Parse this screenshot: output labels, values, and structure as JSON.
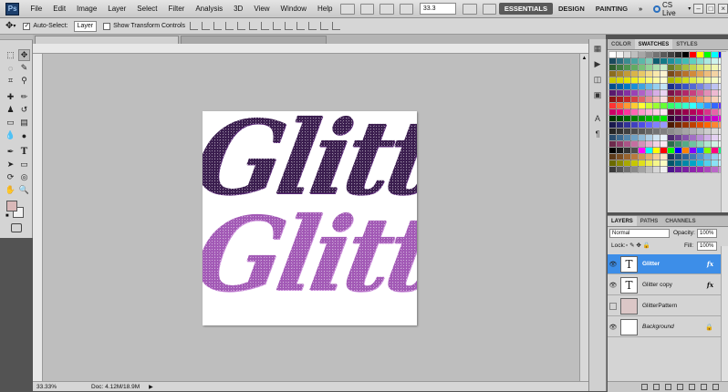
{
  "app": {
    "logo": "Ps"
  },
  "menu": {
    "items": [
      "File",
      "Edit",
      "Image",
      "Layer",
      "Select",
      "Filter",
      "Analysis",
      "3D",
      "View",
      "Window",
      "Help"
    ]
  },
  "menubar": {
    "zoom": "33.3",
    "workspaces": [
      "ESSENTIALS",
      "DESIGN",
      "PAINTING"
    ],
    "more": "»",
    "cs_live": "CS Live"
  },
  "options": {
    "auto_select_label": "Auto-Select:",
    "auto_select_value": "Layer",
    "show_transform_label": "Show Transform Controls"
  },
  "document": {
    "text": "Glitter"
  },
  "status": {
    "zoom": "33.33%",
    "doc_info": "Doc: 4.12M/18.9M"
  },
  "swatches_panel": {
    "tabs": [
      "COLOR",
      "SWATCHES",
      "STYLES"
    ],
    "colors": [
      "#ffffff",
      "#f2f2f2",
      "#d9d9d9",
      "#bfbfbf",
      "#a6a6a6",
      "#8c8c8c",
      "#737373",
      "#595959",
      "#404040",
      "#262626",
      "#000000",
      "#ff0000",
      "#ffff00",
      "#00ff00",
      "#00ffff",
      "#0000ff",
      "#1b4a5c",
      "#2d6e7e",
      "#3c8b8f",
      "#4aa3a0",
      "#5cb8a8",
      "#7fc9b5",
      "#0e5e6f",
      "#127a86",
      "#1d8f9a",
      "#2aa6ab",
      "#3fbcb5",
      "#5fcfc0",
      "#86dccf",
      "#aae8df",
      "#cdf2ec",
      "#e6f9f5",
      "#2e5d2e",
      "#3f7a3f",
      "#4f944f",
      "#62ab62",
      "#78c078",
      "#93d293",
      "#aee0ae",
      "#c8ebc8",
      "#6a7d2a",
      "#8a9f33",
      "#a9bd3f",
      "#c3d44f",
      "#d8e56b",
      "#e7ef8e",
      "#f1f6b3",
      "#f8fbd7",
      "#8c6d1f",
      "#a8832a",
      "#c39b36",
      "#d9b44a",
      "#e8c966",
      "#f2da88",
      "#f8e8ab",
      "#fcf3cf",
      "#7a4a1a",
      "#985d22",
      "#b8722b",
      "#d28a3a",
      "#e3a457",
      "#eebd7c",
      "#f5d3a3",
      "#fae8cd",
      "#c8c800",
      "#d6d600",
      "#e3e300",
      "#eeee1c",
      "#f5f54a",
      "#f9f978",
      "#fbfba5",
      "#fdfdd2",
      "#a8b400",
      "#bccb00",
      "#cfdd1a",
      "#ddeb46",
      "#e8f372",
      "#f0f89c",
      "#f6fbc4",
      "#fafde2",
      "#004f8c",
      "#0063a8",
      "#0078c4",
      "#1a8fd6",
      "#3fa4e0",
      "#6ab9e8",
      "#96cff0",
      "#c2e4f7",
      "#1c2f8a",
      "#2a40a8",
      "#3a53c4",
      "#5569d4",
      "#7683e0",
      "#9aa3ea",
      "#bec3f2",
      "#e0e2f9",
      "#5a1a6e",
      "#6f2487",
      "#842fa0",
      "#9a42b5",
      "#af62c6",
      "#c387d6",
      "#d6aee5",
      "#e9d3f2",
      "#7a1448",
      "#961c58",
      "#b12769",
      "#c7407f",
      "#d6659a",
      "#e38fb6",
      "#eeb9d2",
      "#f7dde9",
      "#8c1414",
      "#a81c1c",
      "#c42727",
      "#d64040",
      "#e06565",
      "#e88f8f",
      "#f0b9b9",
      "#f8dddd",
      "#a83a14",
      "#c44a1c",
      "#dc5c27",
      "#e87840",
      "#f09665",
      "#f5b48f",
      "#f9d1b9",
      "#fce8dd",
      "#ff3333",
      "#ff6633",
      "#ff9933",
      "#ffcc33",
      "#ffff33",
      "#ccff33",
      "#99ff33",
      "#66ff33",
      "#33ff66",
      "#33ff99",
      "#33ffcc",
      "#33ffff",
      "#33ccff",
      "#3399ff",
      "#3366ff",
      "#6633ff",
      "#cc0066",
      "#e6007a",
      "#ff3399",
      "#ff66b3",
      "#ff99cc",
      "#ffb3d9",
      "#ffcce6",
      "#ffe6f2",
      "#660033",
      "#800040",
      "#99004d",
      "#b3005a",
      "#cc0066",
      "#d9338a",
      "#e666a8",
      "#f299c7",
      "#003300",
      "#004d00",
      "#006600",
      "#008000",
      "#009900",
      "#00b300",
      "#00cc00",
      "#00e600",
      "#330033",
      "#4d004d",
      "#660066",
      "#800080",
      "#990099",
      "#b300b3",
      "#cc00cc",
      "#e600e6",
      "#1a1a4d",
      "#262673",
      "#333399",
      "#4040bf",
      "#4d4de6",
      "#6666ff",
      "#8080ff",
      "#9999ff",
      "#4d1a00",
      "#732600",
      "#993300",
      "#bf4000",
      "#e64d00",
      "#ff6600",
      "#ff8533",
      "#ffa366",
      "#262626",
      "#333333",
      "#404040",
      "#4d4d4d",
      "#595959",
      "#666666",
      "#737373",
      "#808080",
      "#8c8c8c",
      "#999999",
      "#a6a6a6",
      "#b3b3b3",
      "#bfbfbf",
      "#cccccc",
      "#d9d9d9",
      "#e6e6e6",
      "#2b4d6e",
      "#3d6a8f",
      "#5486ab",
      "#6fa1c4",
      "#8fbad7",
      "#b0d0e6",
      "#d1e5f2",
      "#e8f2f9",
      "#4d2b6e",
      "#6a3d8f",
      "#8654ab",
      "#a16fc4",
      "#ba8fd7",
      "#d0b0e6",
      "#e5d1f2",
      "#f2e8f9",
      "#6e2b4d",
      "#8f3d6a",
      "#ab5486",
      "#c46fa1",
      "#d78fba",
      "#e6b0d0",
      "#f2d1e5",
      "#f9e8f2",
      "#2b6e4d",
      "#3d8f6a",
      "#54ab86",
      "#6fc4a1",
      "#8fd7ba",
      "#b0e6d0",
      "#d1f2e5",
      "#e8f9f2",
      "#000000",
      "#1a1a1a",
      "#333333",
      "#4d4d4d",
      "#ff00ff",
      "#00ffff",
      "#ffff00",
      "#ff0000",
      "#00ff00",
      "#0000ff",
      "#ff8000",
      "#8000ff",
      "#0080ff",
      "#80ff00",
      "#ff0080",
      "#00ff80",
      "#5c3a1a",
      "#7a4e24",
      "#99632e",
      "#b87a3d",
      "#d19552",
      "#e3b070",
      "#f0cc99",
      "#f9e6c7",
      "#1a3a5c",
      "#244e7a",
      "#2e6399",
      "#3d7ab8",
      "#5295d1",
      "#70b0e3",
      "#99ccf0",
      "#c7e6f9",
      "#6b6b00",
      "#8a8a00",
      "#a8a800",
      "#c7c700",
      "#e0e01a",
      "#ecec52",
      "#f5f58a",
      "#fbfbc2",
      "#00556b",
      "#006f8a",
      "#0089a8",
      "#00a3c7",
      "#1abce0",
      "#52d0ec",
      "#8ae2f5",
      "#c2f1fb",
      "#3b3b3b",
      "#555555",
      "#6f6f6f",
      "#898989",
      "#a3a3a3",
      "#bdbdbd",
      "#d7d7d7",
      "#f1f1f1",
      "#4a148c",
      "#6a1b9a",
      "#7b1fa2",
      "#8e24aa",
      "#9c27b0",
      "#ab47bc",
      "#ba68c8",
      "#ce93d8"
    ]
  },
  "layers_panel": {
    "tabs": [
      "LAYERS",
      "PATHS",
      "CHANNELS"
    ],
    "blend_mode": "Normal",
    "opacity_label": "Opacity:",
    "opacity": "100%",
    "lock_label": "Lock:",
    "fill_label": "Fill:",
    "fill": "100%",
    "layers": [
      {
        "name": "Glitter",
        "thumb": "T",
        "visible": true,
        "fx": "fx",
        "selected": true
      },
      {
        "name": "Glitter copy",
        "thumb": "T",
        "visible": true,
        "fx": "fx",
        "selected": false
      },
      {
        "name": "GlitterPattern",
        "thumb": "",
        "visible": false,
        "fx": "",
        "selected": false
      },
      {
        "name": "Background",
        "thumb": "",
        "visible": true,
        "fx": "",
        "selected": false
      }
    ]
  }
}
